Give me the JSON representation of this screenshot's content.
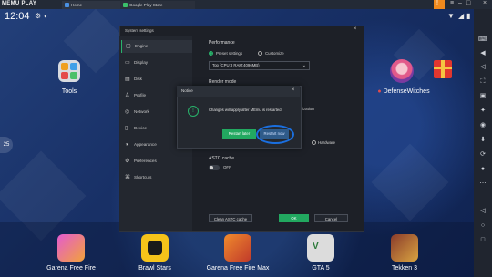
{
  "titlebar": {
    "logo": "MEMU PLAY",
    "tabs": [
      {
        "label": "Home"
      },
      {
        "label": "Google Play Store"
      }
    ]
  },
  "statusbar": {
    "time": "12:04"
  },
  "desktop": {
    "tools_label": "Tools",
    "defensewitches_label": "DefenseWitches",
    "percent": "25"
  },
  "dock": {
    "apps": [
      {
        "label": "Garena Free Fire"
      },
      {
        "label": "Brawl Stars"
      },
      {
        "label": "Garena Free Fire Max"
      },
      {
        "label": "GTA 5"
      },
      {
        "label": "Tekken 3"
      }
    ]
  },
  "settings": {
    "title": "System settings",
    "menu": [
      {
        "label": "Engine"
      },
      {
        "label": "Display"
      },
      {
        "label": "Disk"
      },
      {
        "label": "Profile"
      },
      {
        "label": "Network"
      },
      {
        "label": "Device"
      },
      {
        "label": "Appearance"
      },
      {
        "label": "Preferences"
      },
      {
        "label": "Shortcuts"
      }
    ],
    "performance_label": "Performance",
    "preset_label": "Preset settings",
    "customize_label": "Customize",
    "preset_value": "Top (CPU:8 RAM:4096MB)",
    "render_label": "Render mode",
    "partial_label": "ization",
    "hardware_label": "Hardware",
    "astc_label": "ASTC cache",
    "astc_state": "OFF",
    "clean_astc_label": "Clean ASTC cache",
    "ok_label": "OK",
    "cancel_label": "Cancel"
  },
  "notice": {
    "title": "Notice",
    "message": "Changes will apply after MEmu is restarted",
    "restart_later": "Restart later",
    "restart_now": "Restart now"
  }
}
